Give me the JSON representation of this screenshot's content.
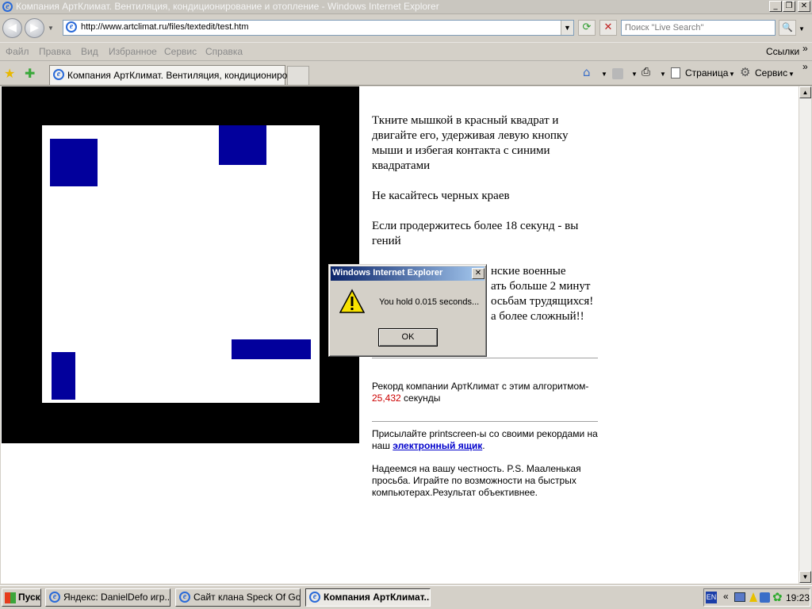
{
  "window": {
    "title": "Компания АртКлимат. Вентиляция, кондиционирование и отопление - Windows Internet Explorer",
    "min_glyph": "_",
    "max_glyph": "❐",
    "close_glyph": "✕"
  },
  "addressbar": {
    "url": "http://www.artclimat.ru/files/textedit/test.htm",
    "search_placeholder": "Поиск \"Live Search\"",
    "back_glyph": "◀",
    "forward_glyph": "▶",
    "refresh_glyph": "⟳",
    "stop_glyph": "✕",
    "search_glyph": "🔍"
  },
  "menu": {
    "items": [
      "Файл",
      "Правка",
      "Вид",
      "Избранное",
      "Сервис",
      "Справка"
    ],
    "links_label": "Ссылки",
    "overflow_glyph": "»"
  },
  "tabs": {
    "active_label": "Компания АртКлимат. Вентиляция, кондициониро...",
    "page_label": "Страница",
    "tools_label": "Сервис",
    "overflow_glyph": "»"
  },
  "page": {
    "para1": "Ткните мышкой в красный квадрат и двигайте его, удерживая левую кнопку мыши и избегая контакта с синими квадратами",
    "para2": "Не касайтесь черных краев",
    "para3": "Если продержитесь более 18 секунд - вы гений",
    "para4_visible_1": "нские военные",
    "para4_visible_2": "ать больше 2 минут",
    "para4_visible_3": "осьбам трудящихся!",
    "para4_visible_4": "а более сложный!!",
    "record_text": "Рекорд компании АртКлимат с этим алгоритмом-",
    "record_value": "25,432",
    "record_unit": " секунды",
    "send_text": "Присылайте printscreen-ы со своими рекордами на наш ",
    "send_link": "электронный ящик",
    "send_end": ".",
    "honesty_text": "Надеемся на вашу честность. P.S. Мааленькая просьба. Играйте по возможности на быстрых компьютерах.Результат объективнее.",
    "record_color": "#cc0000",
    "link_color": "#0000cc"
  },
  "dialog": {
    "title": "Windows Internet Explorer",
    "message": "You hold 0.015 seconds...",
    "ok_label": "OK",
    "warning_icon": "warning-icon"
  },
  "taskbar": {
    "start_label": "Пуск",
    "tasks": [
      "Яндекс: DanielDefo игр...",
      "Сайт клана Speck Of Go...",
      "Компания АртКлимат..."
    ],
    "lang": "EN",
    "clock": "19:23",
    "tray_overflow": "«"
  }
}
